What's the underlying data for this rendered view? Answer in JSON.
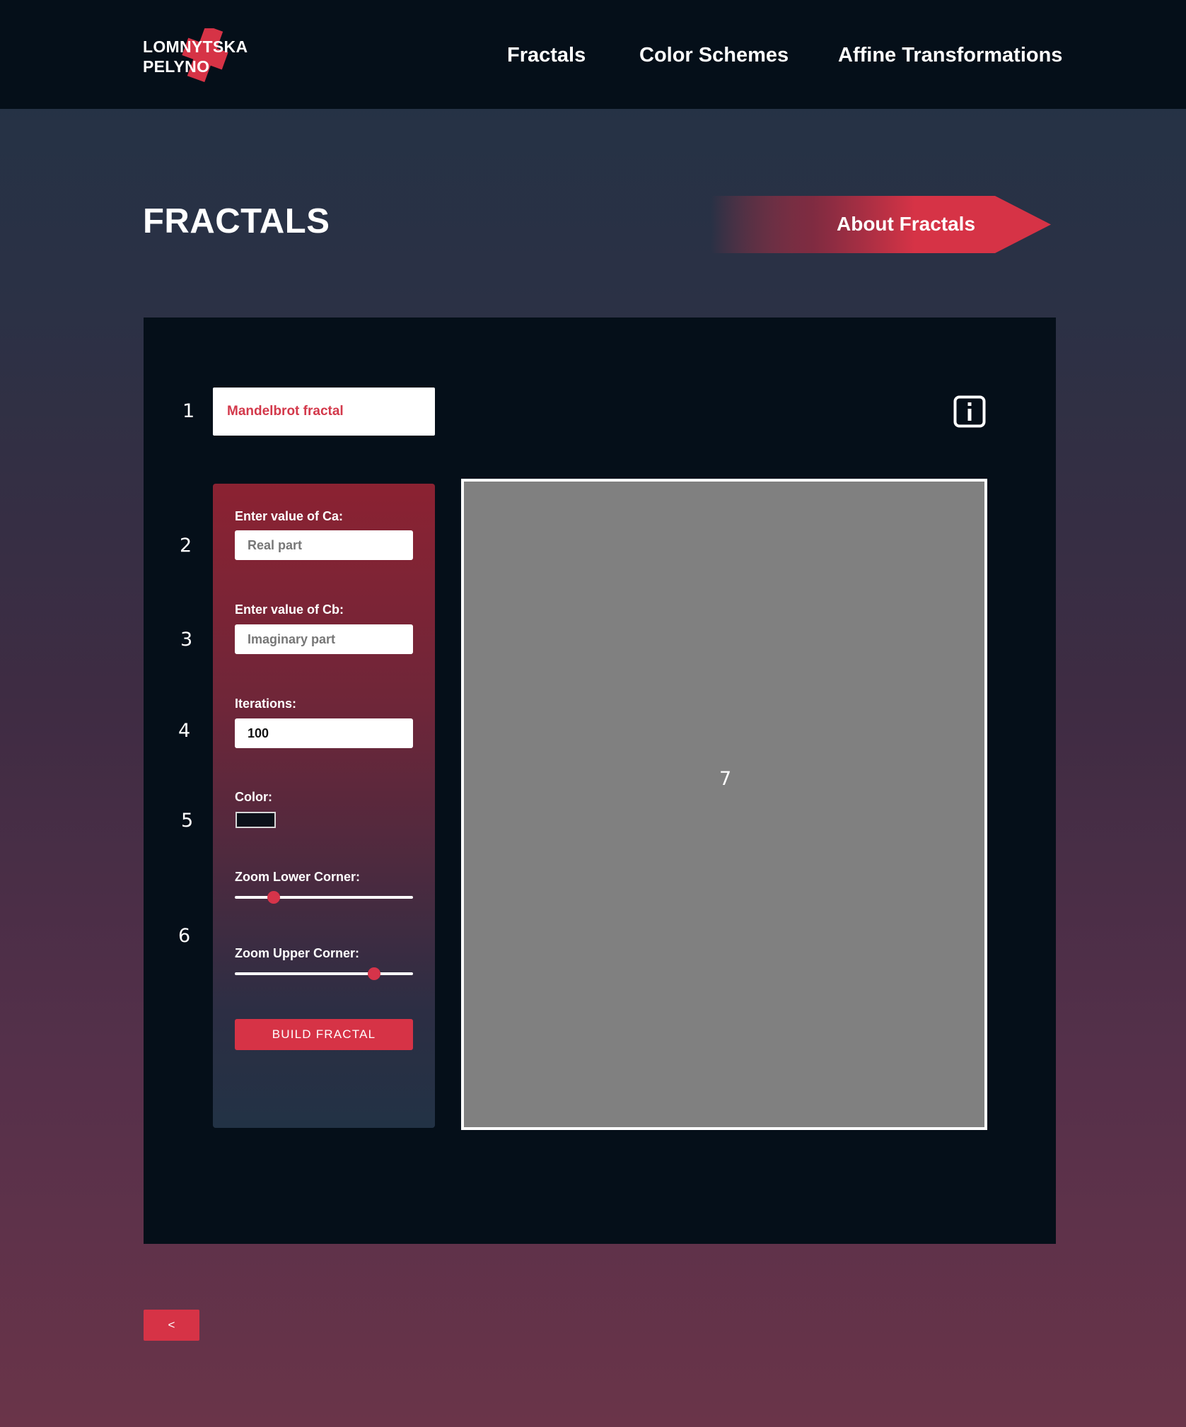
{
  "header": {
    "logo": {
      "line1": "LOMNYTSKA",
      "line2": "PELYNO",
      "accent_color": "#d63346"
    },
    "nav": [
      {
        "label": "Fractals"
      },
      {
        "label": "Color Schemes"
      },
      {
        "label": "Affine Transformations"
      }
    ]
  },
  "page": {
    "title": "FRACTALS",
    "about_button": "About Fractals"
  },
  "markers": [
    "1",
    "2",
    "3",
    "4",
    "5",
    "6",
    "7"
  ],
  "panel": {
    "fractal_select": {
      "value": "Mandelbrot fractal"
    },
    "info_icon": "info-icon",
    "controls": {
      "ca": {
        "label": "Enter value of Ca:",
        "placeholder": "Real part",
        "value": ""
      },
      "cb": {
        "label": "Enter value of Cb:",
        "placeholder": "Imaginary part",
        "value": ""
      },
      "iterations": {
        "label": "Iterations:",
        "value": "100"
      },
      "color": {
        "label": "Color:",
        "value": "#0b1119"
      },
      "zoom_lower": {
        "label": "Zoom Lower Corner:",
        "fraction": 0.22
      },
      "zoom_upper": {
        "label": "Zoom Upper Corner:",
        "fraction": 0.78
      },
      "build_button": "BUILD FRACTAL"
    },
    "canvas": {
      "background": "#808080"
    }
  },
  "footer": {
    "back_button": "<"
  },
  "colors": {
    "accent": "#d63346",
    "header_bg": "#050f19",
    "panel_bg": "#050f19"
  }
}
